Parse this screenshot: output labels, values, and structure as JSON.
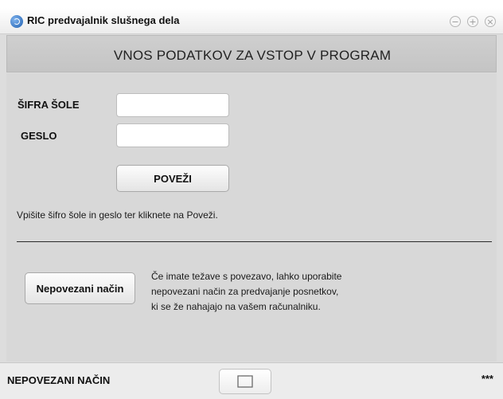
{
  "window": {
    "title": "RIC predvajalnik slušnega dela",
    "controls": {
      "minimize": "−",
      "maximize": "+",
      "close": "×"
    }
  },
  "header": {
    "title": "VNOS PODATKOV ZA VSTOP V PROGRAM"
  },
  "login": {
    "school_code_label": "ŠIFRA ŠOLE",
    "school_code_value": "",
    "password_label": "GESLO",
    "password_value": "",
    "connect_button": "POVEŽI",
    "hint": "Vpišite šifro šole in geslo ter kliknete na Poveži."
  },
  "offline": {
    "button": "Nepovezani način",
    "info_lines": [
      "Če imate težave s povezavo, lahko uporabite",
      "nepovezani način za predvajanje posnetkov,",
      "ki se že nahajajo na vašem računalniku."
    ]
  },
  "footer": {
    "mode_label": "NEPOVEZANI NAČIN",
    "dots": "***"
  },
  "icons": {
    "app": "speaker-icon",
    "footer_button": "resize-corners-icon"
  }
}
